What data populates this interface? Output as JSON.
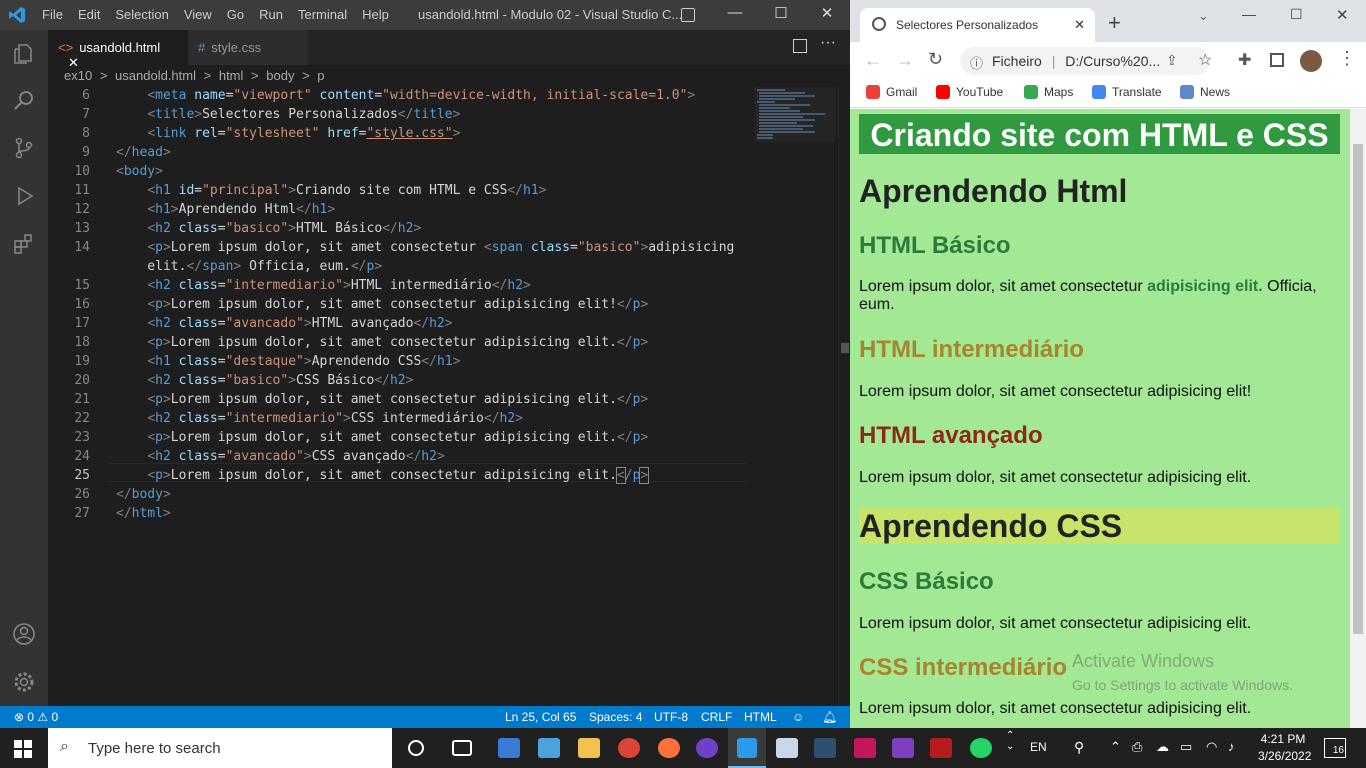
{
  "vscode": {
    "menu": [
      "File",
      "Edit",
      "Selection",
      "View",
      "Go",
      "Run",
      "Terminal",
      "Help"
    ],
    "window_title": "usandold.html - Modulo 02 - Visual Studio C...",
    "tabs": [
      {
        "label": "usandold.html",
        "active": true
      },
      {
        "label": "style.css",
        "active": false
      }
    ],
    "breadcrumb": [
      "ex10",
      ">",
      "usandold.html",
      ">",
      "html",
      ">",
      "body",
      ">",
      "p"
    ],
    "code_lines": [
      {
        "n": "6",
        "html": "    <span class=\"br\">&lt;</span><span class=\"tg\">meta</span> <span class=\"at\">name</span>=<span class=\"sv\">\"viewport\"</span> <span class=\"at\">content</span>=<span class=\"sv\">\"width=device-width, initial-scale=1.0\"</span><span class=\"br\">&gt;</span>"
      },
      {
        "n": "7",
        "html": "    <span class=\"br\">&lt;</span><span class=\"tg\">title</span><span class=\"br\">&gt;</span>Selectores Personalizados<span class=\"br\">&lt;/</span><span class=\"tg\">title</span><span class=\"br\">&gt;</span>"
      },
      {
        "n": "8",
        "html": "    <span class=\"br\">&lt;</span><span class=\"tg\">link</span> <span class=\"at\">rel</span>=<span class=\"sv\">\"stylesheet\"</span> <span class=\"at\">href</span>=<span class=\"sv\" style=\"text-decoration:underline\">\"style.css\"</span><span class=\"br\">&gt;</span>"
      },
      {
        "n": "9",
        "html": "<span class=\"br\">&lt;/</span><span class=\"tg\">head</span><span class=\"br\">&gt;</span>"
      },
      {
        "n": "10",
        "html": "<span class=\"br\">&lt;</span><span class=\"tg\">body</span><span class=\"br\">&gt;</span>"
      },
      {
        "n": "11",
        "html": "    <span class=\"br\">&lt;</span><span class=\"tg\">h1</span> <span class=\"at\">id</span>=<span class=\"sv\">\"principal\"</span><span class=\"br\">&gt;</span>Criando site com HTML e CSS<span class=\"br\">&lt;/</span><span class=\"tg\">h1</span><span class=\"br\">&gt;</span>"
      },
      {
        "n": "12",
        "html": "    <span class=\"br\">&lt;</span><span class=\"tg\">h1</span><span class=\"br\">&gt;</span>Aprendendo Html<span class=\"br\">&lt;/</span><span class=\"tg\">h1</span><span class=\"br\">&gt;</span>"
      },
      {
        "n": "13",
        "html": "    <span class=\"br\">&lt;</span><span class=\"tg\">h2</span> <span class=\"at\">class</span>=<span class=\"sv\">\"basico\"</span><span class=\"br\">&gt;</span>HTML Básico<span class=\"br\">&lt;/</span><span class=\"tg\">h2</span><span class=\"br\">&gt;</span>"
      },
      {
        "n": "14",
        "html": "    <span class=\"br\">&lt;</span><span class=\"tg\">p</span><span class=\"br\">&gt;</span>Lorem ipsum dolor, sit amet consectetur <span class=\"br\">&lt;</span><span class=\"tg\">span</span> <span class=\"at\">class</span>=<span class=\"sv\">\"basico\"</span><span class=\"br\">&gt;</span>adipisicing"
      },
      {
        "n": "",
        "html": "    elit.<span class=\"br\">&lt;/</span><span class=\"tg\">span</span><span class=\"br\">&gt;</span> Officia, eum.<span class=\"br\">&lt;/</span><span class=\"tg\">p</span><span class=\"br\">&gt;</span>"
      },
      {
        "n": "15",
        "html": "    <span class=\"br\">&lt;</span><span class=\"tg\">h2</span> <span class=\"at\">class</span>=<span class=\"sv\">\"intermediario\"</span><span class=\"br\">&gt;</span>HTML intermediário<span class=\"br\">&lt;/</span><span class=\"tg\">h2</span><span class=\"br\">&gt;</span>"
      },
      {
        "n": "16",
        "html": "    <span class=\"br\">&lt;</span><span class=\"tg\">p</span><span class=\"br\">&gt;</span>Lorem ipsum dolor, sit amet consectetur adipisicing elit!<span class=\"br\">&lt;/</span><span class=\"tg\">p</span><span class=\"br\">&gt;</span>"
      },
      {
        "n": "17",
        "html": "    <span class=\"br\">&lt;</span><span class=\"tg\">h2</span> <span class=\"at\">class</span>=<span class=\"sv\">\"avancado\"</span><span class=\"br\">&gt;</span>HTML avançado<span class=\"br\">&lt;/</span><span class=\"tg\">h2</span><span class=\"br\">&gt;</span>"
      },
      {
        "n": "18",
        "html": "    <span class=\"br\">&lt;</span><span class=\"tg\">p</span><span class=\"br\">&gt;</span>Lorem ipsum dolor, sit amet consectetur adipisicing elit.<span class=\"br\">&lt;/</span><span class=\"tg\">p</span><span class=\"br\">&gt;</span>"
      },
      {
        "n": "19",
        "html": "    <span class=\"br\">&lt;</span><span class=\"tg\">h1</span> <span class=\"at\">class</span>=<span class=\"sv\">\"destaque\"</span><span class=\"br\">&gt;</span>Aprendendo CSS<span class=\"br\">&lt;/</span><span class=\"tg\">h1</span><span class=\"br\">&gt;</span>"
      },
      {
        "n": "20",
        "html": "    <span class=\"br\">&lt;</span><span class=\"tg\">h2</span> <span class=\"at\">class</span>=<span class=\"sv\">\"basico\"</span><span class=\"br\">&gt;</span>CSS Básico<span class=\"br\">&lt;/</span><span class=\"tg\">h2</span><span class=\"br\">&gt;</span>"
      },
      {
        "n": "21",
        "html": "    <span class=\"br\">&lt;</span><span class=\"tg\">p</span><span class=\"br\">&gt;</span>Lorem ipsum dolor, sit amet consectetur adipisicing elit.<span class=\"br\">&lt;/</span><span class=\"tg\">p</span><span class=\"br\">&gt;</span>"
      },
      {
        "n": "22",
        "html": "    <span class=\"br\">&lt;</span><span class=\"tg\">h2</span> <span class=\"at\">class</span>=<span class=\"sv\">\"intermediario\"</span><span class=\"br\">&gt;</span>CSS intermediário<span class=\"br\">&lt;/</span><span class=\"tg\">h2</span><span class=\"br\">&gt;</span>"
      },
      {
        "n": "23",
        "html": "    <span class=\"br\">&lt;</span><span class=\"tg\">p</span><span class=\"br\">&gt;</span>Lorem ipsum dolor, sit amet consectetur adipisicing elit.<span class=\"br\">&lt;/</span><span class=\"tg\">p</span><span class=\"br\">&gt;</span>"
      },
      {
        "n": "24",
        "html": "    <span class=\"br\">&lt;</span><span class=\"tg\">h2</span> <span class=\"at\">class</span>=<span class=\"sv\">\"avancado\"</span><span class=\"br\">&gt;</span>CSS avançado<span class=\"br\">&lt;/</span><span class=\"tg\">h2</span><span class=\"br\">&gt;</span>"
      },
      {
        "n": "25",
        "html": "    <span class=\"br\">&lt;</span><span class=\"tg\">p</span><span class=\"br\">&gt;</span>Lorem ipsum dolor, sit amet consectetur adipisicing elit.<span class=\"br\" style=\"outline:1px solid #888\">&lt;</span><span class=\"br\">/</span><span class=\"tg\">p</span><span class=\"br\" style=\"outline:1px solid #888\">&gt;</span>"
      },
      {
        "n": "26",
        "html": "<span class=\"br\">&lt;/</span><span class=\"tg\">body</span><span class=\"br\">&gt;</span>"
      },
      {
        "n": "27",
        "html": "<span class=\"br\">&lt;/</span><span class=\"tg\">html</span><span class=\"br\">&gt;</span>"
      }
    ],
    "status": {
      "problems": "⊗ 0 ⚠ 0",
      "position": "Ln 25, Col 65",
      "spaces": "Spaces: 4",
      "encoding": "UTF-8",
      "eol": "CRLF",
      "language": "HTML"
    }
  },
  "chrome": {
    "tab_title": "Selectores Personalizados",
    "omnibox_label": "Ficheiro",
    "omnibox_url": "D:/Curso%20...",
    "bookmarks": [
      "Gmail",
      "YouTube",
      "Maps",
      "Translate",
      "News"
    ],
    "page": {
      "h1_principal": "Criando site com HTML e CSS",
      "h1_html": "Aprendendo Html",
      "h2_html_basico": "HTML Básico",
      "p1_start": "Lorem ipsum dolor, sit amet consectetur ",
      "p1_span": "adipisicing elit.",
      "p1_end": " Officia, eum.",
      "h2_html_inter": "HTML intermediário",
      "p2": "Lorem ipsum dolor, sit amet consectetur adipisicing elit!",
      "h2_html_avan": "HTML avançado",
      "p3": "Lorem ipsum dolor, sit amet consectetur adipisicing elit.",
      "h1_css": "Aprendendo CSS",
      "h2_css_basico": "CSS Básico",
      "p4": "Lorem ipsum dolor, sit amet consectetur adipisicing elit.",
      "h2_css_inter": "CSS intermediário",
      "p5": "Lorem ipsum dolor, sit amet consectetur adipisicing elit."
    },
    "watermark_title": "Activate Windows",
    "watermark_sub": "Go to Settings to activate Windows."
  },
  "taskbar": {
    "search_placeholder": "Type here to search",
    "lang": "EN",
    "time": "4:21 PM",
    "date": "3/26/2022",
    "notifications": "16"
  },
  "colors": {
    "vscode_blue": "#007acc",
    "page_bg": "#a3e894",
    "principal_bg": "#2f9a40",
    "destaque_bg": "#c7e36a"
  }
}
